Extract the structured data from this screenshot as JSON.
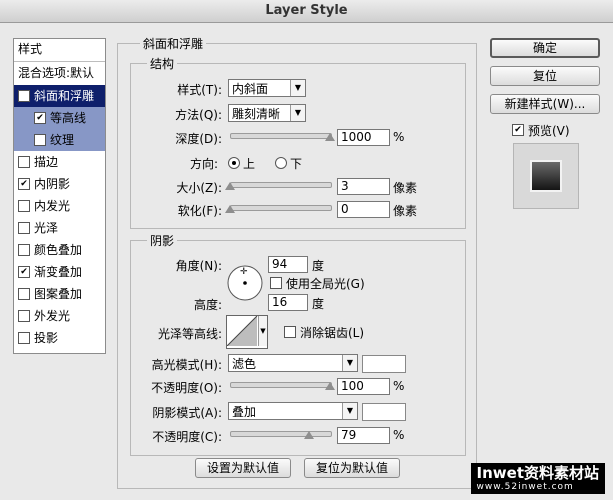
{
  "window": {
    "title": "Layer Style"
  },
  "left": {
    "header": "样式",
    "blend": "混合选项:默认",
    "items": [
      {
        "label": "斜面和浮雕",
        "checked": true
      },
      {
        "label": "等高线",
        "checked": true
      },
      {
        "label": "纹理",
        "checked": false
      },
      {
        "label": "描边",
        "checked": false
      },
      {
        "label": "内阴影",
        "checked": true
      },
      {
        "label": "内发光",
        "checked": false
      },
      {
        "label": "光泽",
        "checked": false
      },
      {
        "label": "颜色叠加",
        "checked": false
      },
      {
        "label": "渐变叠加",
        "checked": true
      },
      {
        "label": "图案叠加",
        "checked": false
      },
      {
        "label": "外发光",
        "checked": false
      },
      {
        "label": "投影",
        "checked": false
      }
    ]
  },
  "bevel": {
    "title": "斜面和浮雕",
    "structure_title": "结构",
    "style_label": "样式(T):",
    "style_value": "内斜面",
    "technique_label": "方法(Q):",
    "technique_value": "雕刻清晰",
    "depth_label": "深度(D):",
    "depth_value": "1000",
    "depth_unit": "%",
    "depth_fill": 1.0,
    "direction_label": "方向:",
    "dir_up": "上",
    "dir_down": "下",
    "size_label": "大小(Z):",
    "size_value": "3",
    "size_unit": "像素",
    "size_fill": 0.0,
    "soften_label": "软化(F):",
    "soften_value": "0",
    "soften_unit": "像素",
    "soften_fill": 0.0
  },
  "shading": {
    "title": "阴影",
    "angle_label": "角度(N):",
    "angle_value": "94",
    "angle_unit": "度",
    "global_label": "使用全局光(G)",
    "altitude_label": "高度:",
    "altitude_value": "16",
    "altitude_unit": "度",
    "gloss_label": "光泽等高线:",
    "antialias_label": "消除锯齿(L)",
    "highlight_label": "高光模式(H):",
    "highlight_value": "滤色",
    "hl_opacity_label": "不透明度(O):",
    "hl_opacity_value": "100",
    "hl_opacity_unit": "%",
    "hl_opacity_fill": 1.0,
    "shadow_label": "阴影模式(A):",
    "shadow_value": "叠加",
    "sh_opacity_label": "不透明度(C):",
    "sh_opacity_value": "79",
    "sh_opacity_unit": "%",
    "sh_opacity_fill": 0.79
  },
  "buttons": {
    "ok": "确定",
    "reset": "复位",
    "new_style": "新建样式(W)...",
    "preview": "预览(V)",
    "make_default": "设置为默认值",
    "reset_default": "复位为默认值"
  },
  "watermark": {
    "brand": "Inwet资料素材站",
    "url": "www.52inwet.com"
  }
}
